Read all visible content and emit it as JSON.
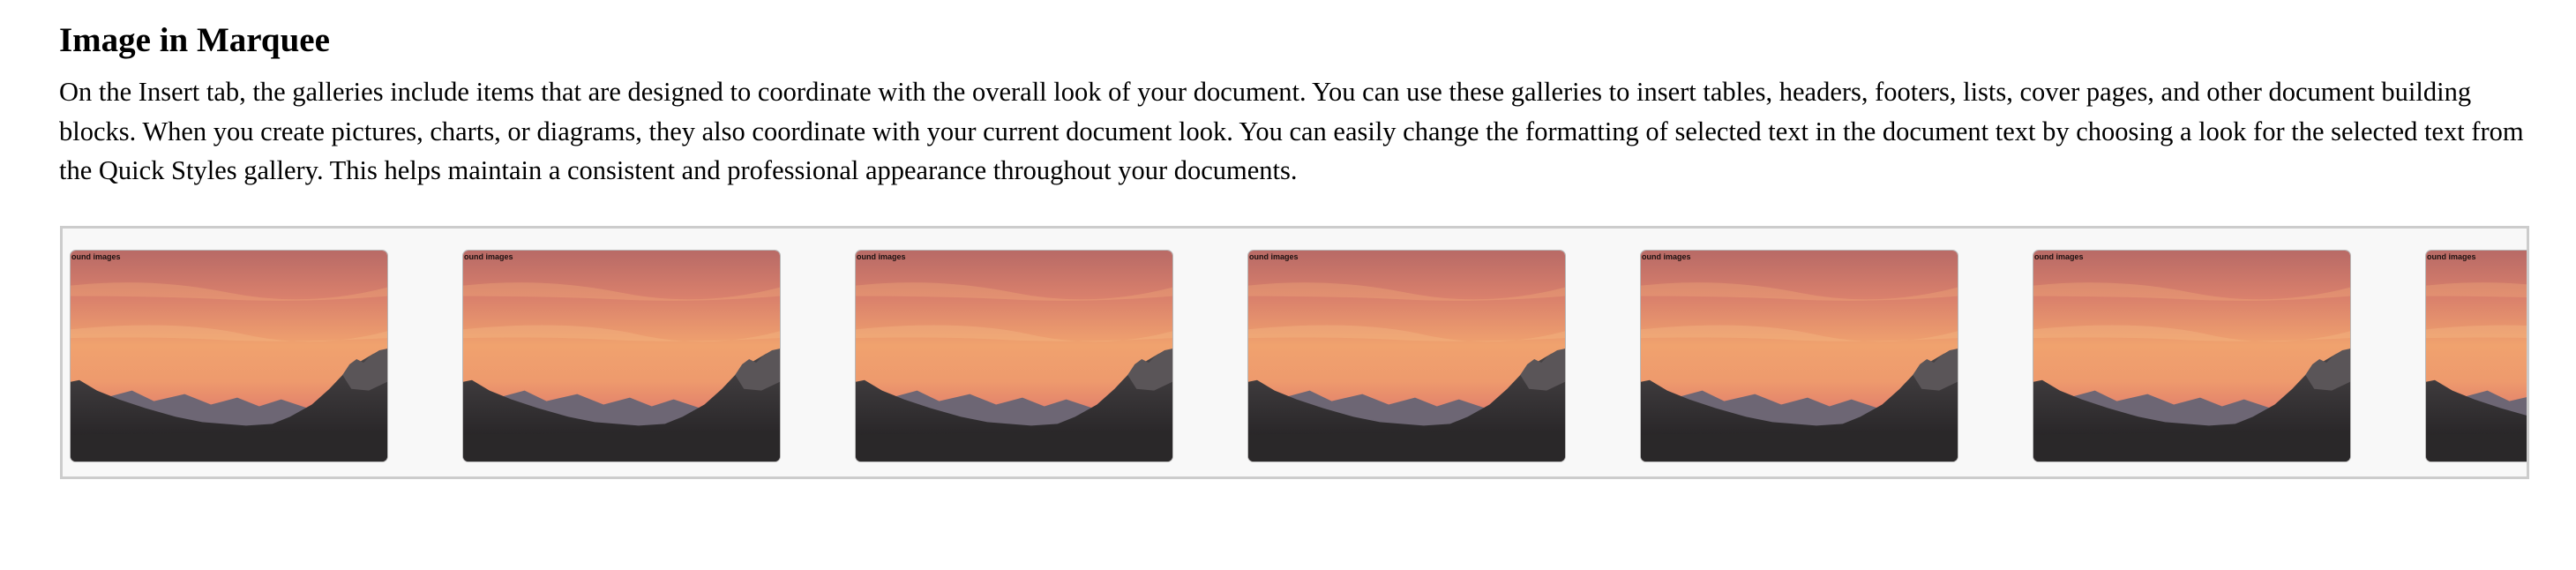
{
  "page": {
    "title": "Image in Marquee",
    "paragraph": "On the Insert tab, the galleries include items that are designed to coordinate with the overall look of your document. You can use these galleries to insert tables, headers, footers, lists, cover pages, and other document building blocks. When you create pictures, charts, or diagrams, they also coordinate with your current document look. You can easily change the formatting of selected text in the document text by choosing a look for the selected text from the Quick Styles gallery. This helps maintain a consistent and professional appearance throughout your documents."
  },
  "marquee": {
    "items": [
      {
        "caption": "ound images"
      },
      {
        "caption": "ound images"
      },
      {
        "caption": "ound images"
      },
      {
        "caption": "ound images"
      },
      {
        "caption": "ound images"
      },
      {
        "caption": "ound images"
      },
      {
        "caption": "ound images"
      }
    ],
    "colors": {
      "border": "#cccccc",
      "background": "#f8f8f8",
      "sky_top": "#c77a6a",
      "sky_mid": "#f0a06a",
      "sky_bottom": "#e58e6c",
      "mountains": "#3a3838"
    }
  }
}
